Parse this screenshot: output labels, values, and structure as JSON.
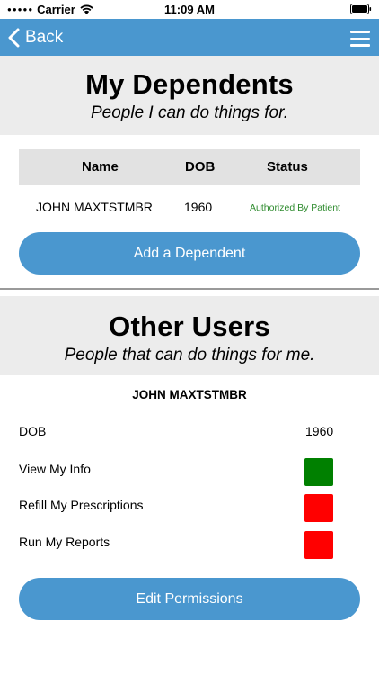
{
  "status_bar": {
    "carrier": "Carrier",
    "time": "11:09 AM"
  },
  "nav": {
    "back_label": "Back"
  },
  "dependents": {
    "title": "My Dependents",
    "subtitle": "People I can do things for.",
    "columns": {
      "name": "Name",
      "dob": "DOB",
      "status": "Status"
    },
    "rows": [
      {
        "name": "JOHN MAXTSTMBR",
        "dob": "1960",
        "status": "Authorized By Patient"
      }
    ],
    "add_button": "Add a Dependent"
  },
  "other_users": {
    "title": "Other Users",
    "subtitle": "People that can do things for me.",
    "user_name": "JOHN MAXTSTMBR",
    "dob_label": "DOB",
    "dob_value": "1960",
    "permissions": [
      {
        "label": "View My Info",
        "enabled": true
      },
      {
        "label": "Refill My Prescriptions",
        "enabled": false
      },
      {
        "label": "Run My Reports",
        "enabled": false
      }
    ],
    "edit_button": "Edit Permissions"
  },
  "colors": {
    "accent": "#4a97cf",
    "permission_on": "#008000",
    "permission_off": "#ff0000",
    "status_text": "#2e8b2e"
  }
}
